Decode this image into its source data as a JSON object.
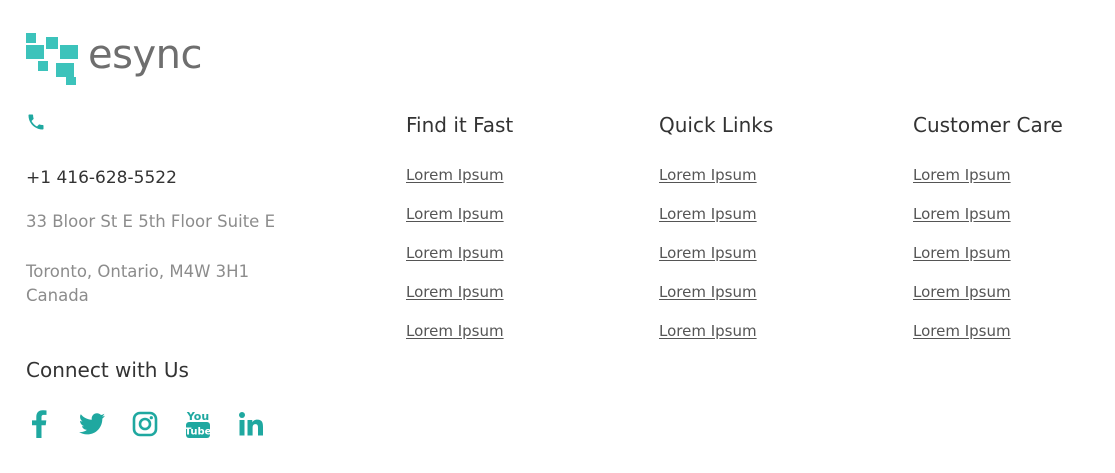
{
  "brand": {
    "name": "esync",
    "accent_color": "#1fa8a0",
    "text_color": "#6e6e6e"
  },
  "contact": {
    "phone_icon": "phone-icon",
    "phone": "+1 416-628-5522",
    "address_line1": "33 Bloor St E 5th Floor Suite E",
    "address_line2": "Toronto, Ontario, M4W 3H1",
    "address_line3": "Canada"
  },
  "connect": {
    "title": "Connect with Us",
    "icons": [
      "facebook-icon",
      "twitter-icon",
      "instagram-icon",
      "youtube-icon",
      "linkedin-icon"
    ]
  },
  "columns": [
    {
      "title": "Find it Fast",
      "links": [
        "Lorem Ipsum",
        "Lorem Ipsum",
        "Lorem Ipsum",
        "Lorem Ipsum",
        "Lorem Ipsum"
      ]
    },
    {
      "title": "Quick Links",
      "links": [
        "Lorem Ipsum",
        "Lorem Ipsum",
        "Lorem Ipsum",
        "Lorem Ipsum",
        "Lorem Ipsum"
      ]
    },
    {
      "title": "Customer Care",
      "links": [
        "Lorem Ipsum",
        "Lorem Ipsum",
        "Lorem Ipsum",
        "Lorem Ipsum",
        "Lorem Ipsum"
      ]
    }
  ]
}
